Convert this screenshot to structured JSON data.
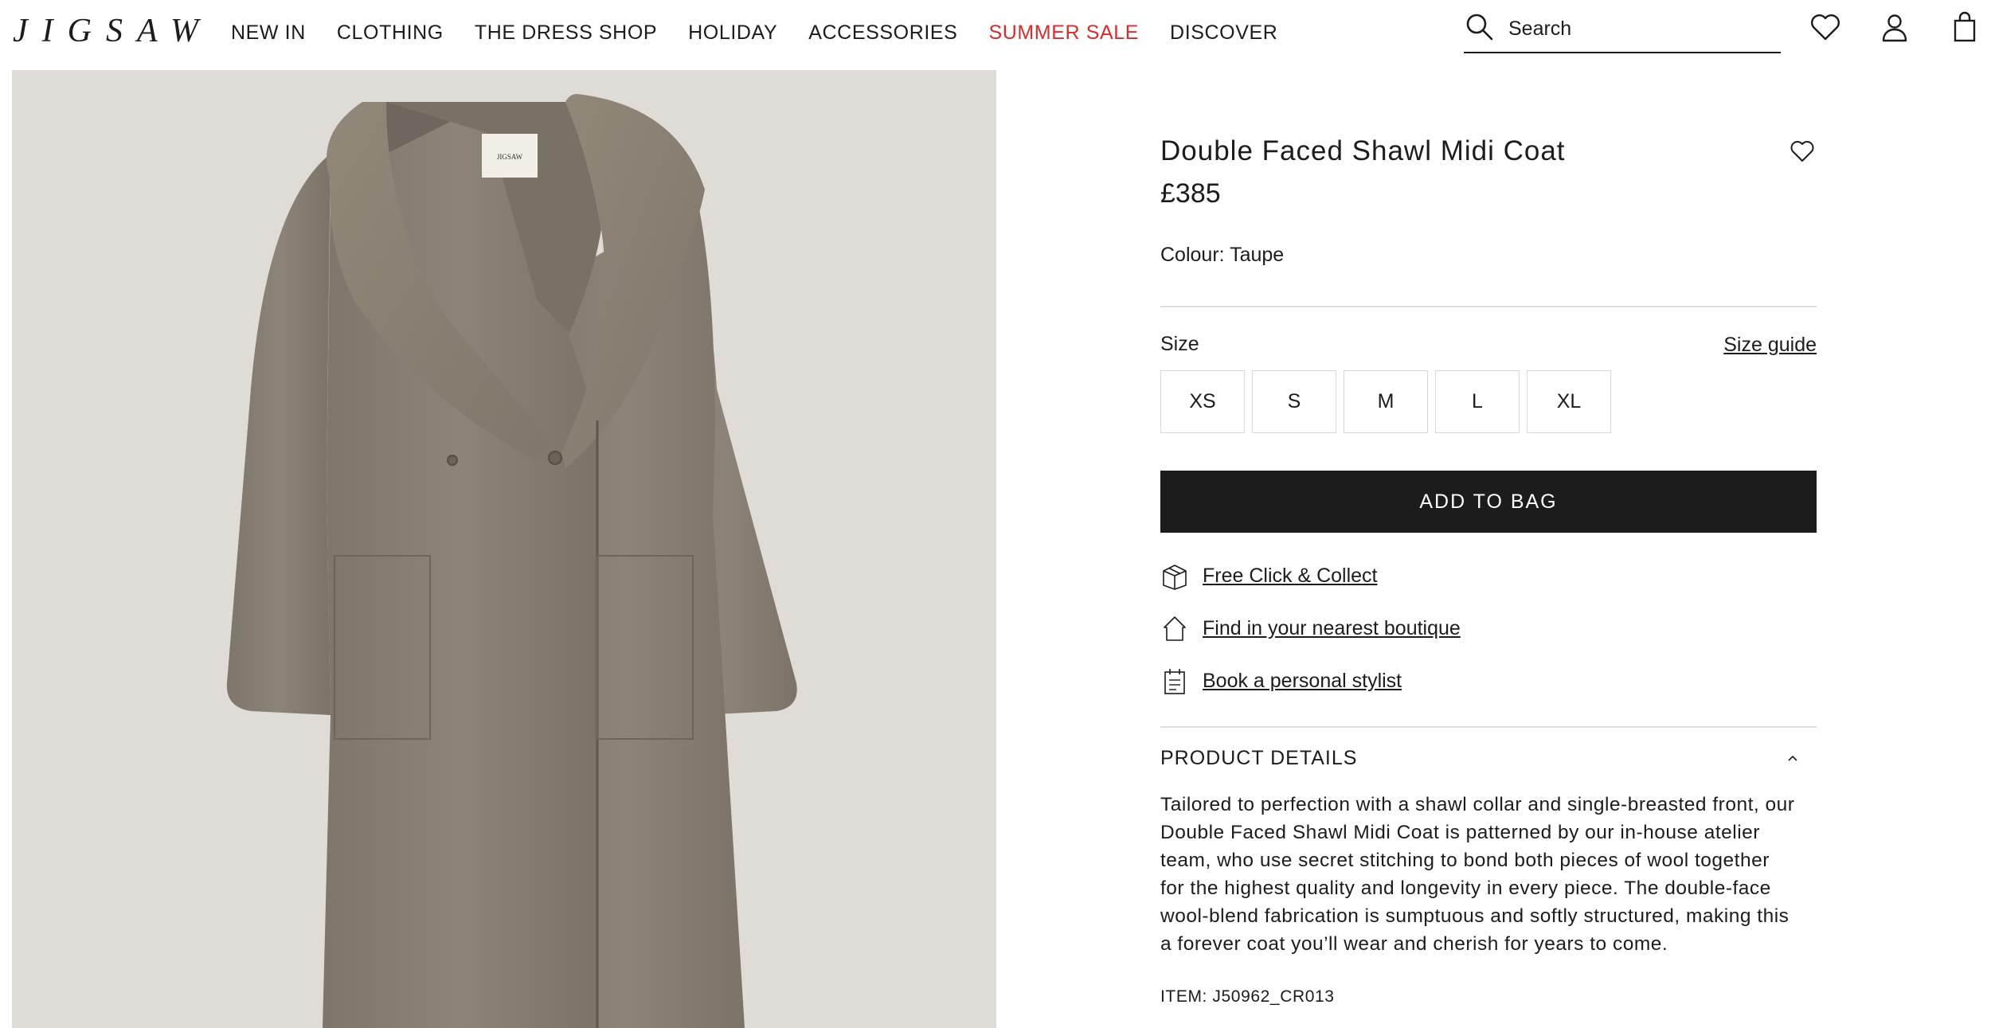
{
  "brand": {
    "logo_text": "JIGSAW"
  },
  "nav": {
    "items": [
      {
        "label": "NEW IN"
      },
      {
        "label": "CLOTHING"
      },
      {
        "label": "THE DRESS SHOP"
      },
      {
        "label": "HOLIDAY"
      },
      {
        "label": "ACCESSORIES"
      },
      {
        "label": "SUMMER SALE"
      },
      {
        "label": "DISCOVER"
      }
    ],
    "sale_color": "#d92b2b"
  },
  "search": {
    "placeholder": "Search"
  },
  "header_icons": [
    "wishlist-icon",
    "account-icon",
    "bag-icon"
  ],
  "product": {
    "title": "Double Faced Shawl Midi Coat",
    "price": "£385",
    "colour": "Colour: Taupe",
    "size_label": "Size",
    "size_guide": "Size guide",
    "sizes": [
      "XS",
      "S",
      "M",
      "L",
      "XL"
    ],
    "add_to_bag": "ADD TO BAG",
    "services": [
      {
        "icon": "box-icon",
        "label": "Free Click & Collect"
      },
      {
        "icon": "house-icon",
        "label": "Find in your nearest boutique"
      },
      {
        "icon": "calendar-icon",
        "label": "Book a personal stylist"
      }
    ],
    "details_heading": "PRODUCT DETAILS",
    "details_text": "Tailored to perfection with a shawl collar and single-breasted front, our Double Faced Shawl Midi Coat is patterned by our in-house atelier team, who use secret stitching to bond both pieces of wool together for the highest quality and longevity in every piece. The double-face wool-blend fabrication is sumptuous and softly structured, making this a forever coat you’ll wear and cherish for years to come.",
    "item_code": "ITEM: J50962_CR013",
    "image_alt_label": "JIGSAW",
    "colors": {
      "coat": "#8a8176",
      "background": "#dfdcd8",
      "button": "#1c1c1c"
    }
  }
}
